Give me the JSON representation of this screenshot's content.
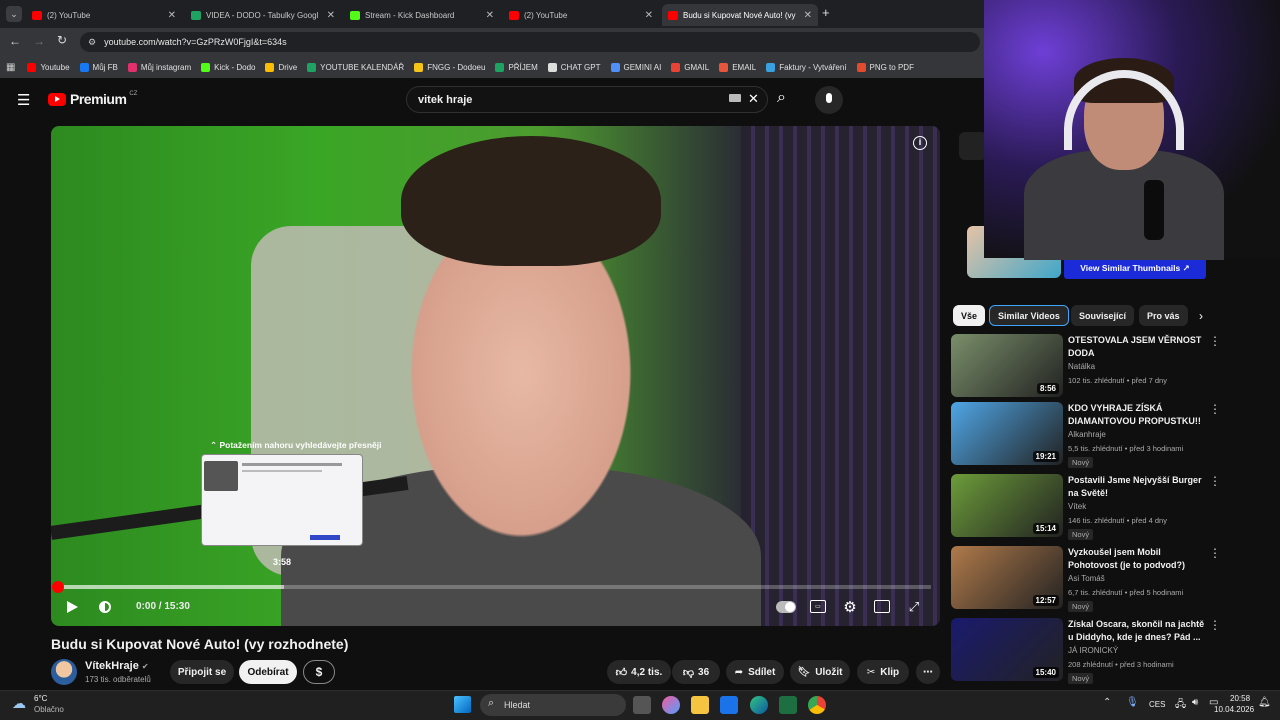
{
  "tabs": [
    {
      "title": "(2) YouTube",
      "color": "#ff0000"
    },
    {
      "title": "VIDEA - DODO - Tabulky Googl",
      "color": "#1ea362"
    },
    {
      "title": "Stream - Kick Dashboard",
      "color": "#53fc18"
    },
    {
      "title": "(2) YouTube",
      "color": "#ff0000"
    },
    {
      "title": "Budu si Kupovat Nové Auto! (vy",
      "color": "#ff0000",
      "active": true
    }
  ],
  "url": "youtube.com/watch?v=GzPRzW0FjgI&t=634s",
  "bookmarks": [
    {
      "label": "Youtube",
      "color": "#ff0000"
    },
    {
      "label": "Můj FB",
      "color": "#1877f2"
    },
    {
      "label": "Můj instagram",
      "color": "#e1306c"
    },
    {
      "label": "Kick - Dodo",
      "color": "#53fc18"
    },
    {
      "label": "Drive",
      "color": "#fbbc04"
    },
    {
      "label": "YOUTUBE KALENDÁŘ",
      "color": "#1ea362"
    },
    {
      "label": "FNGG - Dodoeu",
      "color": "#f5c518"
    },
    {
      "label": "PŘÍJEM",
      "color": "#1ea362"
    },
    {
      "label": "CHAT GPT",
      "color": "#dddddd"
    },
    {
      "label": "GEMINI AI",
      "color": "#4f8ff7"
    },
    {
      "label": "GMAIL",
      "color": "#ea4335"
    },
    {
      "label": "EMAIL",
      "color": "#e8553b"
    },
    {
      "label": "Faktury - Vytváření",
      "color": "#3aa0e0"
    },
    {
      "label": "PNG to PDF",
      "color": "#e34b2f"
    }
  ],
  "yt": {
    "logo": "Premium",
    "region": "CZ",
    "search_value": "vitek hraje"
  },
  "player": {
    "scrub_hint": "⌃ Potažením nahoru vyhledávejte přesněji",
    "preview_time": "3:58",
    "timecode": "0:00 / 15:30",
    "progress": 0.0,
    "buffered": 0.26
  },
  "video": {
    "title": "Budu si Kupovat Nové Auto! (vy rozhodnete)",
    "channel": "VítekHraje",
    "subscribers": "173 tis. odběratelů",
    "join_label": "Připojit se",
    "subscribe_label": "Odebírat",
    "thanks_label": "$",
    "likes": "4,2 tis.",
    "dislikes": "36",
    "share_label": "Sdílet",
    "save_label": "Uložit",
    "clip_label": "Klip"
  },
  "sidebar": {
    "similar_button": "View Similar Thumbnails ↗",
    "chips": [
      "Vše",
      "Similar Videos",
      "Související",
      "Pro vás"
    ],
    "recs": [
      {
        "title": "OTESTOVALA JSEM VĚRNOST DODA",
        "channel": "Natálka",
        "meta": "102 tis. zhlédnutí • před 7 dny",
        "duration": "8:56",
        "new": "",
        "thumb": "#7a8f6a"
      },
      {
        "title": "KDO VYHRAJE ZÍSKÁ DIAMANTOVOU PROPUSTKU!!",
        "channel": "Alkanhraje",
        "meta": "5,5 tis. zhlédnutí • před 3 hodinami",
        "duration": "19:21",
        "new": "Nový",
        "thumb": "#4fa6e6"
      },
      {
        "title": "Postavili Jsme Nejvyšší Burger na Světě!",
        "channel": "Vítek",
        "meta": "146 tis. zhlédnutí • před 4 dny",
        "duration": "15:14",
        "new": "Nový",
        "thumb": "#6c9c3a"
      },
      {
        "title": "Vyzkoušel jsem Mobil Pohotovost (je to podvod?)",
        "channel": "Asi Tomáš",
        "meta": "6,7 tis. zhlédnutí • před 5 hodinami",
        "duration": "12:57",
        "new": "Nový",
        "thumb": "#b07a4a"
      },
      {
        "title": "Získal Oscara, skončil na jachtě u Diddyho, kde je dnes? Pád ...",
        "channel": "JÁ IRONICKÝ",
        "meta": "208 zhlédnutí • před 3 hodinami",
        "duration": "15:40",
        "new": "Nový",
        "thumb": "#1a1a6e"
      }
    ]
  },
  "taskbar": {
    "temp": "6°C",
    "weather": "Oblačno",
    "search_placeholder": "Hledat",
    "lang": "CES",
    "time": "20:58",
    "date": "10.04.2026"
  }
}
